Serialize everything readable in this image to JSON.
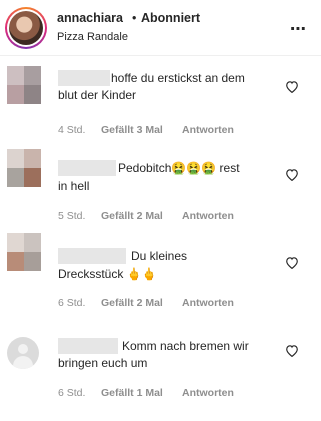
{
  "header": {
    "username": "annachiara",
    "separator": "•",
    "follow_status": "Abonniert",
    "location": "Pizza Randale",
    "more_icon": "⋯"
  },
  "colors": {
    "text": "#262626",
    "meta": "#8e8e8e",
    "redaction": "#e6e6e6"
  },
  "comments": [
    {
      "line1": "hoffe du erstickst an dem",
      "line2": "blut der Kinder",
      "time": "4 Std.",
      "likes": "Gefällt 3 Mal",
      "reply": "Antworten"
    },
    {
      "line1": "Pedobitch",
      "line1_emoji": "🤮🤮🤮",
      "line1_tail": "rest",
      "line2": "in hell",
      "time": "5 Std.",
      "likes": "Gefällt 2 Mal",
      "reply": "Antworten"
    },
    {
      "line1": "Du kleines",
      "line2": "Drecksstück",
      "line2_emoji": "🖕🖕",
      "time": "6 Std.",
      "likes": "Gefällt 2 Mal",
      "reply": "Antworten"
    },
    {
      "line1": "Komm nach bremen wir",
      "line2": "bringen euch um",
      "time": "6 Std.",
      "likes": "Gefällt 1 Mal",
      "reply": "Antworten"
    }
  ]
}
